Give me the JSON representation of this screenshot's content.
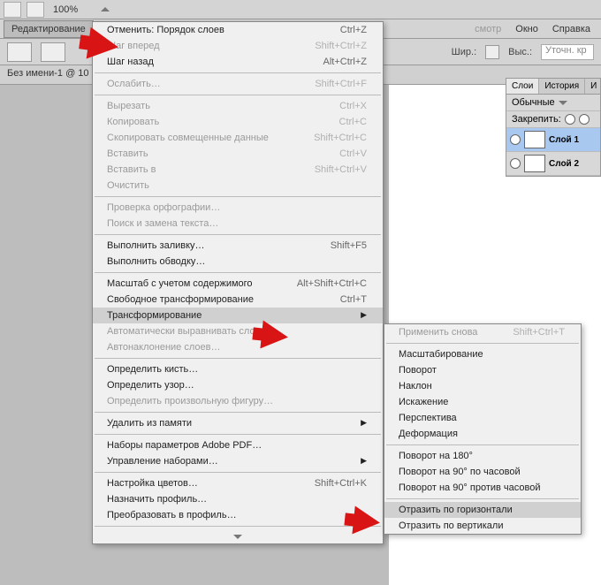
{
  "topbar": {
    "zoom": "100%"
  },
  "menubar": {
    "edit": "Редактирование",
    "view_partial": "смотр",
    "window": "Окно",
    "help": "Справка"
  },
  "optionsbar": {
    "width_lbl": "Шир.:",
    "height_lbl": "Выс.:",
    "refine": "Уточн. кр"
  },
  "doc_tab": "Без имени-1 @ 10",
  "edit_menu": {
    "undo": "Отменить: Порядок слоев",
    "undo_sc": "Ctrl+Z",
    "step_fwd": "Шаг вперед",
    "step_fwd_sc": "Shift+Ctrl+Z",
    "step_back": "Шаг назад",
    "step_back_sc": "Alt+Ctrl+Z",
    "fade": "Ослабить…",
    "fade_sc": "Shift+Ctrl+F",
    "cut": "Вырезать",
    "cut_sc": "Ctrl+X",
    "copy": "Копировать",
    "copy_sc": "Ctrl+C",
    "copy_merged": "Скопировать совмещенные данные",
    "copy_merged_sc": "Shift+Ctrl+C",
    "paste": "Вставить",
    "paste_sc": "Ctrl+V",
    "paste_into": "Вставить в",
    "paste_into_sc": "Shift+Ctrl+V",
    "clear": "Очистить",
    "spell": "Проверка орфографии…",
    "findreplace": "Поиск и замена текста…",
    "fill": "Выполнить заливку…",
    "fill_sc": "Shift+F5",
    "stroke": "Выполнить обводку…",
    "content_scale": "Масштаб с учетом содержимого",
    "content_scale_sc": "Alt+Shift+Ctrl+C",
    "free_transform": "Свободное трансформирование",
    "free_transform_sc": "Ctrl+T",
    "transform": "Трансформирование",
    "auto_align": "Автоматически выравнивать слои…",
    "annotation": "Автонаклонение слоев…",
    "define_brush": "Определить кисть…",
    "define_pattern": "Определить узор…",
    "define_shape": "Определить произвольную фигуру…",
    "purge": "Удалить из памяти",
    "pdf_presets": "Наборы параметров Adobe PDF…",
    "manage_presets": "Управление наборами…",
    "color_settings": "Настройка цветов…",
    "color_settings_sc": "Shift+Ctrl+K",
    "assign_profile": "Назначить профиль…",
    "convert_profile": "Преобразовать в профиль…"
  },
  "transform_sub": {
    "again": "Применить снова",
    "again_sc": "Shift+Ctrl+T",
    "scale": "Масштабирование",
    "rotate": "Поворот",
    "skew": "Наклон",
    "distort": "Искажение",
    "perspective": "Перспектива",
    "warp": "Деформация",
    "rot180": "Поворот на 180°",
    "rot90cw": "Поворот на 90° по часовой",
    "rot90ccw": "Поворот на 90° против часовой",
    "flip_h": "Отразить по горизонтали",
    "flip_v": "Отразить по вертикали"
  },
  "layers": {
    "tab_layers": "Слои",
    "tab_history": "История",
    "tab_more": "И",
    "mode": "Обычные",
    "lock_lbl": "Закрепить:",
    "layer1": "Слой 1",
    "layer2": "Слой 2"
  }
}
